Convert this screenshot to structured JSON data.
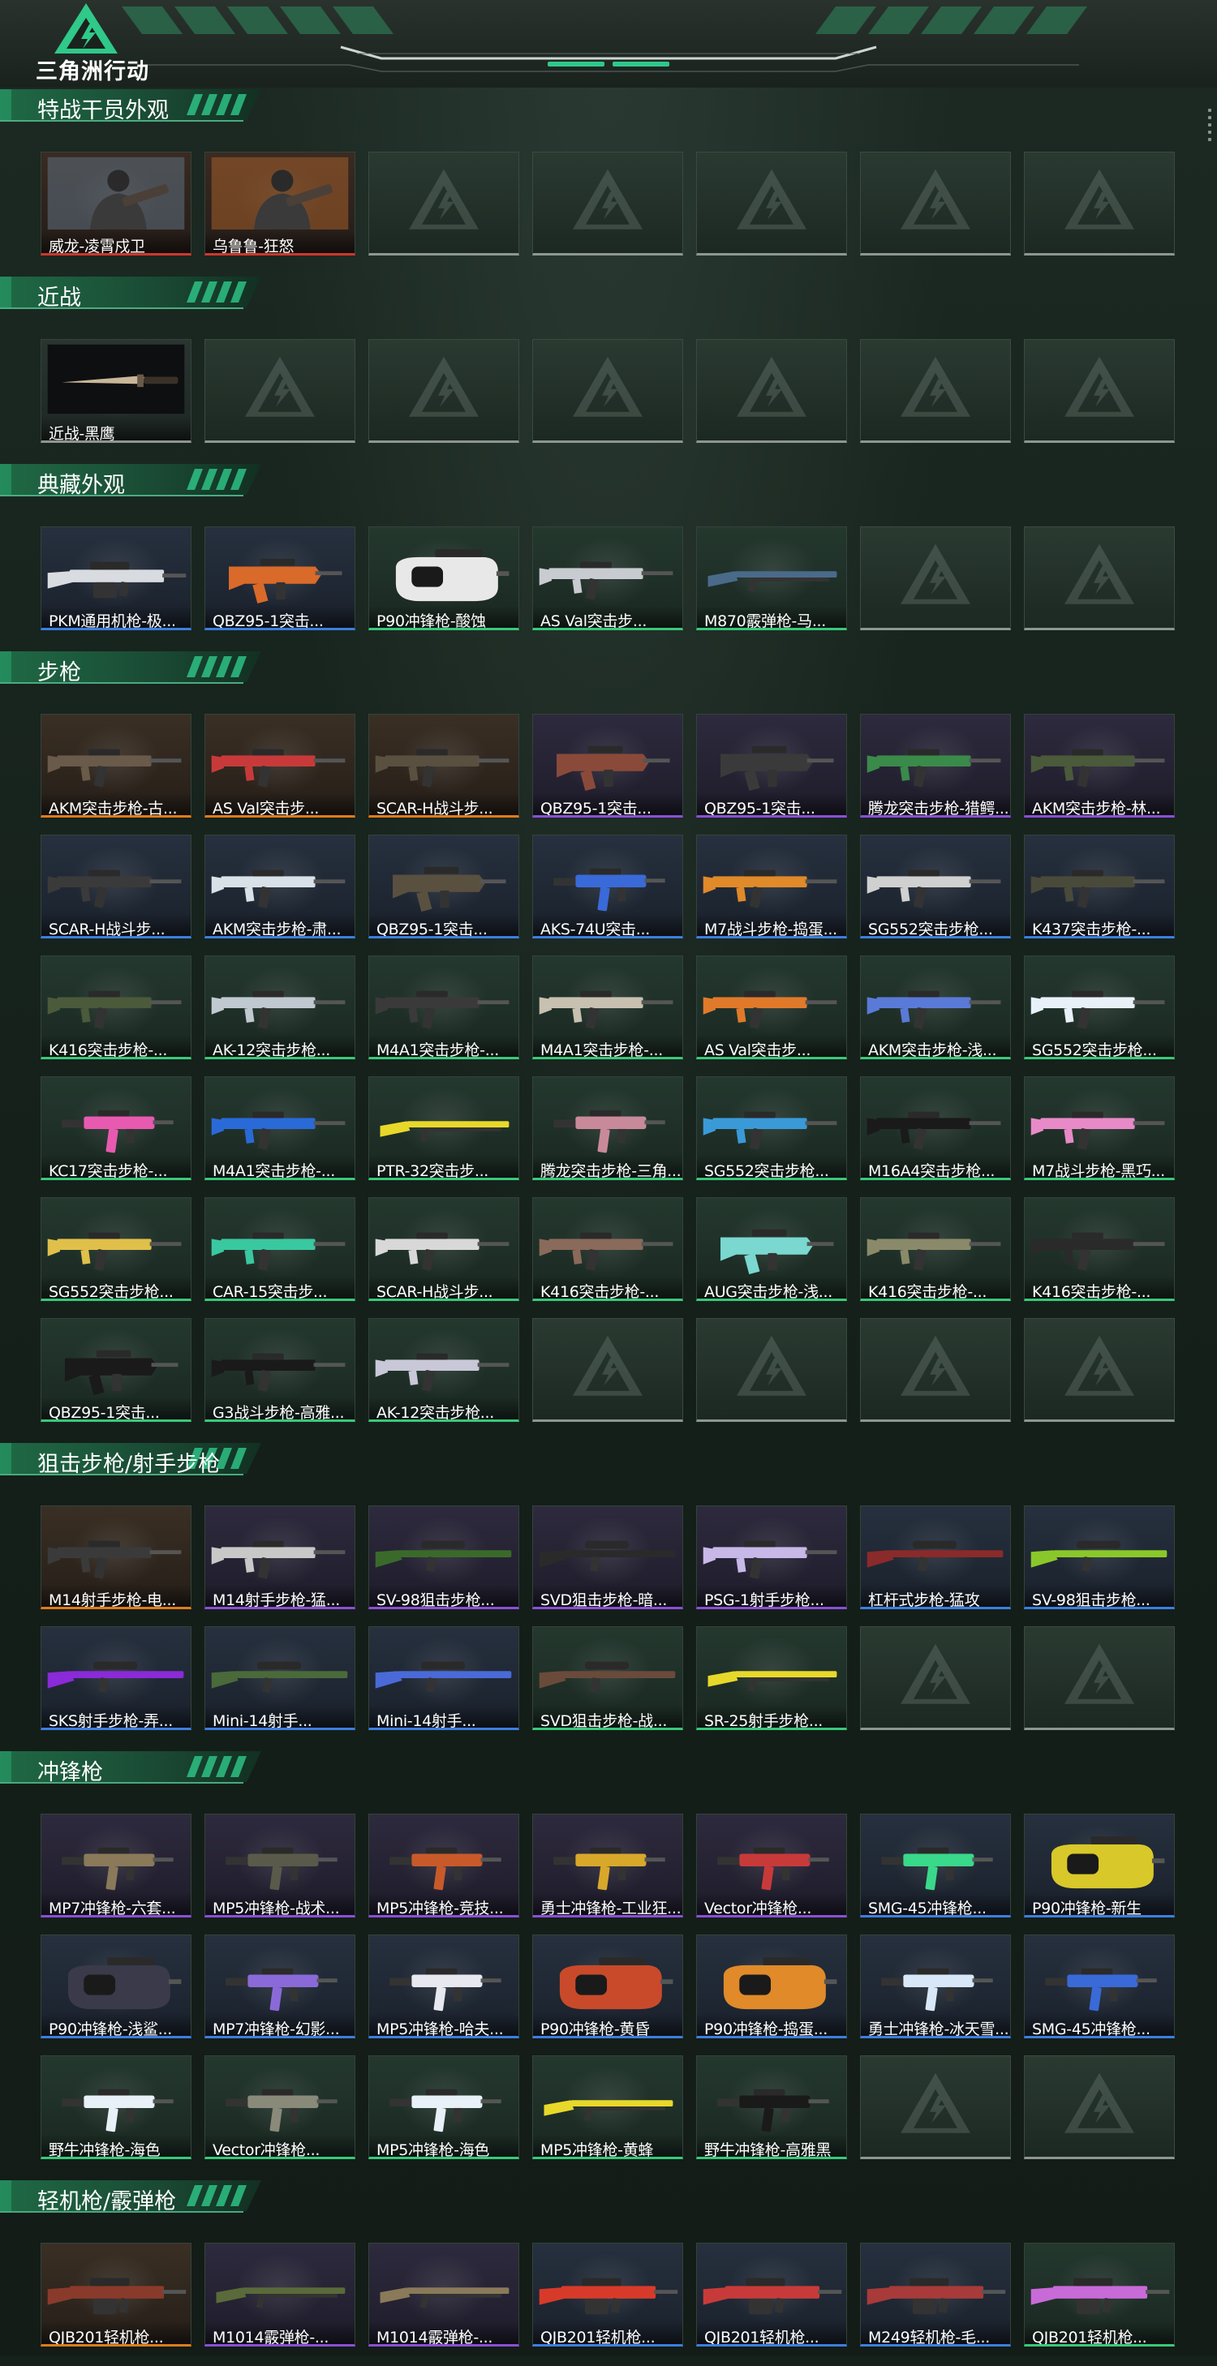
{
  "app": {
    "logo_text": "三角洲行动"
  },
  "icons": {
    "logo": "delta-logo-icon",
    "scroll": "scroll-dots-icon",
    "empty": "delta-watermark-icon"
  },
  "colors": {
    "red": "#d0362c",
    "orange": "#e07b1a",
    "purple": "#8a4fd8",
    "blue": "#3b7fe0",
    "green": "#39c97a",
    "gray": "#8d978f",
    "accent": "#2fc98a"
  },
  "sections": [
    {
      "title": "特战干员外观",
      "items": [
        {
          "label": "威龙-凌霄戍卫",
          "rarity": "red",
          "art": "operator",
          "tint": "#5a6a78"
        },
        {
          "label": "乌鲁鲁-狂怒",
          "rarity": "red",
          "art": "operator",
          "tint": "#9a5a2a"
        },
        {
          "empty": true
        },
        {
          "empty": true
        },
        {
          "empty": true
        },
        {
          "empty": true
        },
        {
          "empty": true
        }
      ]
    },
    {
      "title": "近战",
      "items": [
        {
          "label": "近战-黑鹰",
          "rarity": "gray",
          "art": "knife",
          "tint": "#c9b79a"
        },
        {
          "empty": true
        },
        {
          "empty": true
        },
        {
          "empty": true
        },
        {
          "empty": true
        },
        {
          "empty": true
        },
        {
          "empty": true
        }
      ]
    },
    {
      "title": "典藏外观",
      "items": [
        {
          "label": "PKM通用机枪-极...",
          "rarity": "blue",
          "art": "lmg",
          "tint": "#d8dce0"
        },
        {
          "label": "QBZ95-1突击...",
          "rarity": "blue",
          "art": "bullpup",
          "tint": "#d96a2a"
        },
        {
          "label": "P90冲锋枪-酸蚀",
          "rarity": "green",
          "art": "p90",
          "tint": "#e8e8e8"
        },
        {
          "label": "AS Val突击步...",
          "rarity": "green",
          "art": "rifle",
          "tint": "#c8ccd0"
        },
        {
          "label": "M870霰弹枪-马...",
          "rarity": "green",
          "art": "shotgun",
          "tint": "#4a6a8a"
        },
        {
          "empty": true
        },
        {
          "empty": true
        }
      ]
    },
    {
      "title": "步枪",
      "items": [
        {
          "label": "AKM突击步枪-古...",
          "rarity": "orange",
          "art": "rifle",
          "tint": "#6a5a4a"
        },
        {
          "label": "AS Val突击步...",
          "rarity": "orange",
          "art": "rifle",
          "tint": "#c83a3a"
        },
        {
          "label": "SCAR-H战斗步...",
          "rarity": "orange",
          "art": "rifle",
          "tint": "#5a5040"
        },
        {
          "label": "QBZ95-1突击...",
          "rarity": "purple",
          "art": "bullpup",
          "tint": "#8a4a3a"
        },
        {
          "label": "QBZ95-1突击...",
          "rarity": "purple",
          "art": "bullpup",
          "tint": "#3a3a3a"
        },
        {
          "label": "腾龙突击步枪-猎鳄...",
          "rarity": "purple",
          "art": "rifle",
          "tint": "#3a8a4a"
        },
        {
          "label": "AKM突击步枪-林...",
          "rarity": "purple",
          "art": "rifle",
          "tint": "#4a5a3a"
        },
        {
          "label": "SCAR-H战斗步...",
          "rarity": "blue",
          "art": "rifle",
          "tint": "#3a3a3a"
        },
        {
          "label": "AKM突击步枪-肃...",
          "rarity": "blue",
          "art": "rifle",
          "tint": "#d8e0e8"
        },
        {
          "label": "QBZ95-1突击...",
          "rarity": "blue",
          "art": "bullpup",
          "tint": "#5a5040"
        },
        {
          "label": "AKS-74U突击...",
          "rarity": "blue",
          "art": "smg",
          "tint": "#3a6ad8"
        },
        {
          "label": "M7战斗步枪-捣蛋...",
          "rarity": "blue",
          "art": "rifle",
          "tint": "#e08a2a"
        },
        {
          "label": "SG552突击步枪...",
          "rarity": "blue",
          "art": "rifle",
          "tint": "#d0d0d0"
        },
        {
          "label": "K437突击步枪-...",
          "rarity": "blue",
          "art": "rifle",
          "tint": "#4a4a3a"
        },
        {
          "label": "K416突击步枪-...",
          "rarity": "green",
          "art": "rifle",
          "tint": "#4a5a3a"
        },
        {
          "label": "AK-12突击步枪...",
          "rarity": "green",
          "art": "rifle",
          "tint": "#c0c8d0"
        },
        {
          "label": "M4A1突击步枪-...",
          "rarity": "green",
          "art": "rifle",
          "tint": "#3a3a3a"
        },
        {
          "label": "M4A1突击步枪-...",
          "rarity": "green",
          "art": "rifle",
          "tint": "#c8c0b0"
        },
        {
          "label": "AS Val突击步...",
          "rarity": "green",
          "art": "rifle",
          "tint": "#e07a2a"
        },
        {
          "label": "AKM突击步枪-浅...",
          "rarity": "green",
          "art": "rifle",
          "tint": "#5a7ad8"
        },
        {
          "label": "SG552突击步枪...",
          "rarity": "green",
          "art": "rifle",
          "tint": "#e8f0f8"
        },
        {
          "label": "KC17突击步枪-...",
          "rarity": "green",
          "art": "smg",
          "tint": "#e85ab0"
        },
        {
          "label": "M4A1突击步枪-...",
          "rarity": "green",
          "art": "rifle",
          "tint": "#2a6ad8"
        },
        {
          "label": "PTR-32突击步...",
          "rarity": "green",
          "art": "shotgun",
          "tint": "#e8d82a"
        },
        {
          "label": "腾龙突击步枪-三角...",
          "rarity": "green",
          "art": "smg",
          "tint": "#c88a9a"
        },
        {
          "label": "SG552突击步枪...",
          "rarity": "green",
          "art": "rifle",
          "tint": "#3a9ad8"
        },
        {
          "label": "M16A4突击步枪...",
          "rarity": "green",
          "art": "rifle",
          "tint": "#1a1a1a"
        },
        {
          "label": "M7战斗步枪-黑巧...",
          "rarity": "green",
          "art": "rifle",
          "tint": "#e88ac8"
        },
        {
          "label": "SG552突击步枪...",
          "rarity": "green",
          "art": "rifle",
          "tint": "#e0c04a"
        },
        {
          "label": "CAR-15突击步...",
          "rarity": "green",
          "art": "rifle",
          "tint": "#3ac8a0"
        },
        {
          "label": "SCAR-H战斗步...",
          "rarity": "green",
          "art": "rifle",
          "tint": "#d8d8d8"
        },
        {
          "label": "K416突击步枪-...",
          "rarity": "green",
          "art": "rifle",
          "tint": "#8a6a5a"
        },
        {
          "label": "AUG突击步枪-浅...",
          "rarity": "green",
          "art": "bullpup",
          "tint": "#7ad8d0"
        },
        {
          "label": "K416突击步枪-...",
          "rarity": "green",
          "art": "rifle",
          "tint": "#8a8a6a"
        },
        {
          "label": "K416突击步枪-...",
          "rarity": "green",
          "art": "rifle",
          "tint": "#2a2a2a"
        },
        {
          "label": "QBZ95-1突击...",
          "rarity": "green",
          "art": "bullpup",
          "tint": "#1a1a1a"
        },
        {
          "label": "G3战斗步枪-高雅...",
          "rarity": "green",
          "art": "rifle",
          "tint": "#1a1a1a"
        },
        {
          "label": "AK-12突击步枪...",
          "rarity": "green",
          "art": "rifle",
          "tint": "#c8c8d8"
        },
        {
          "empty": true
        },
        {
          "empty": true
        },
        {
          "empty": true
        },
        {
          "empty": true
        }
      ]
    },
    {
      "title": "狙击步枪/射手步枪",
      "items": [
        {
          "label": "M14射手步枪-电...",
          "rarity": "orange",
          "art": "rifle",
          "tint": "#3a3a3a"
        },
        {
          "label": "M14射手步枪-猛...",
          "rarity": "purple",
          "art": "rifle",
          "tint": "#c8c8c8"
        },
        {
          "label": "SV-98狙击步枪...",
          "rarity": "purple",
          "art": "sniper",
          "tint": "#3a6a2a"
        },
        {
          "label": "SVD狙击步枪-暗...",
          "rarity": "purple",
          "art": "sniper",
          "tint": "#2a2a2a"
        },
        {
          "label": "PSG-1射手步枪...",
          "rarity": "purple",
          "art": "rifle",
          "tint": "#c8b8e8"
        },
        {
          "label": "杠杆式步枪-猛攻",
          "rarity": "blue",
          "art": "sniper",
          "tint": "#8a2a2a"
        },
        {
          "label": "SV-98狙击步枪...",
          "rarity": "blue",
          "art": "sniper",
          "tint": "#8ac82a"
        },
        {
          "label": "SKS射手步枪-弄...",
          "rarity": "blue",
          "art": "sniper",
          "tint": "#8a2ad8"
        },
        {
          "label": "Mini-14射手...",
          "rarity": "blue",
          "art": "sniper",
          "tint": "#4a6a3a"
        },
        {
          "label": "Mini-14射手...",
          "rarity": "blue",
          "art": "sniper",
          "tint": "#4a6ad8"
        },
        {
          "label": "SVD狙击步枪-战...",
          "rarity": "green",
          "art": "sniper",
          "tint": "#6a4a3a"
        },
        {
          "label": "SR-25射手步枪...",
          "rarity": "green",
          "art": "shotgun",
          "tint": "#e8d82a"
        },
        {
          "empty": true
        },
        {
          "empty": true
        }
      ]
    },
    {
      "title": "冲锋枪",
      "items": [
        {
          "label": "MP7冲锋枪-六套...",
          "rarity": "purple",
          "art": "smg",
          "tint": "#8a7a5a"
        },
        {
          "label": "MP5冲锋枪-战术...",
          "rarity": "purple",
          "art": "smg",
          "tint": "#5a5a4a"
        },
        {
          "label": "MP5冲锋枪-竞技...",
          "rarity": "purple",
          "art": "smg",
          "tint": "#c85a2a"
        },
        {
          "label": "勇士冲锋枪-工业狂...",
          "rarity": "purple",
          "art": "smg",
          "tint": "#d8a82a"
        },
        {
          "label": "Vector冲锋枪...",
          "rarity": "purple",
          "art": "smg",
          "tint": "#c83a3a"
        },
        {
          "label": "SMG-45冲锋枪...",
          "rarity": "blue",
          "art": "smg",
          "tint": "#3ad88a"
        },
        {
          "label": "P90冲锋枪-新生",
          "rarity": "blue",
          "art": "p90",
          "tint": "#d8c82a"
        },
        {
          "label": "P90冲锋枪-浅鲨...",
          "rarity": "blue",
          "art": "p90",
          "tint": "#3a3a4a"
        },
        {
          "label": "MP7冲锋枪-幻影...",
          "rarity": "blue",
          "art": "smg",
          "tint": "#8a6ad8"
        },
        {
          "label": "MP5冲锋枪-哈夫...",
          "rarity": "blue",
          "art": "smg",
          "tint": "#e8e8f0"
        },
        {
          "label": "P90冲锋枪-黄昏",
          "rarity": "blue",
          "art": "p90",
          "tint": "#c84a2a"
        },
        {
          "label": "P90冲锋枪-捣蛋...",
          "rarity": "blue",
          "art": "p90",
          "tint": "#e08a2a"
        },
        {
          "label": "勇士冲锋枪-冰天雪...",
          "rarity": "blue",
          "art": "smg",
          "tint": "#d8e8f8"
        },
        {
          "label": "SMG-45冲锋枪...",
          "rarity": "blue",
          "art": "smg",
          "tint": "#3a6ad8"
        },
        {
          "label": "野牛冲锋枪-海色",
          "rarity": "green",
          "art": "smg",
          "tint": "#e8f0f8"
        },
        {
          "label": "Vector冲锋枪...",
          "rarity": "green",
          "art": "smg",
          "tint": "#8a8a7a"
        },
        {
          "label": "MP5冲锋枪-海色",
          "rarity": "green",
          "art": "smg",
          "tint": "#e8f0f8"
        },
        {
          "label": "MP5冲锋枪-黄蜂",
          "rarity": "green",
          "art": "shotgun",
          "tint": "#e8d82a"
        },
        {
          "label": "野牛冲锋枪-高雅黑",
          "rarity": "green",
          "art": "smg",
          "tint": "#1a1a1a"
        },
        {
          "empty": true
        },
        {
          "empty": true
        }
      ]
    },
    {
      "title": "轻机枪/霰弹枪",
      "items": [
        {
          "label": "QJB201轻机枪...",
          "rarity": "orange",
          "art": "lmg",
          "tint": "#8a3a2a"
        },
        {
          "label": "M1014霰弹枪-...",
          "rarity": "purple",
          "art": "shotgun",
          "tint": "#5a6a3a"
        },
        {
          "label": "M1014霰弹枪-...",
          "rarity": "purple",
          "art": "shotgun",
          "tint": "#8a7a5a"
        },
        {
          "label": "QJB201轻机枪...",
          "rarity": "blue",
          "art": "lmg",
          "tint": "#d83a2a"
        },
        {
          "label": "QJB201轻机枪...",
          "rarity": "blue",
          "art": "lmg",
          "tint": "#c83a3a"
        },
        {
          "label": "M249轻机枪-毛...",
          "rarity": "blue",
          "art": "lmg",
          "tint": "#a83a3a"
        },
        {
          "label": "QJB201轻机枪...",
          "rarity": "green",
          "art": "lmg",
          "tint": "#c86ad8"
        }
      ]
    }
  ]
}
